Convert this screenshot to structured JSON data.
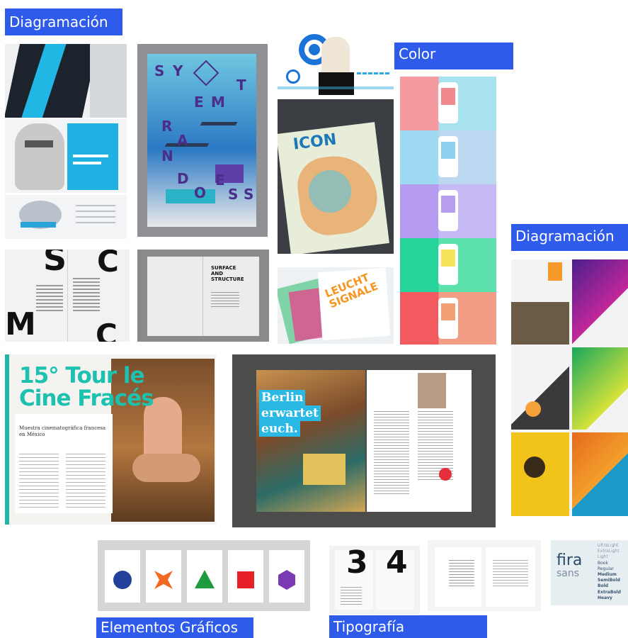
{
  "labels": {
    "diagramacion_top": "Diagramación",
    "color": "Color",
    "diagramacion_right": "Diagramación",
    "elementos": "Elementos Gráficos",
    "tipografia": "Tipografía"
  },
  "poster": {
    "letters": [
      "S",
      "Y",
      "T",
      "E",
      "M",
      "R",
      "A",
      "N",
      "D",
      "O",
      "E",
      "S",
      "S"
    ]
  },
  "magazine_icon": {
    "title": "ICON"
  },
  "swiss": {
    "letters": [
      "S",
      "C",
      "M",
      "C"
    ]
  },
  "surface_book": {
    "title_lines": [
      "SURFACE",
      "AND",
      "STRUCTURE"
    ]
  },
  "leucht": {
    "title_lines": [
      "LEUCHT",
      "SIGNALE"
    ]
  },
  "cine": {
    "title_line1": "15° Tour le",
    "title_line2": "Cine Fracés",
    "subtitle": "Muestra cinematográfica francesa en México"
  },
  "berlin": {
    "lines": [
      "Berlin",
      "erwartet",
      "euch."
    ]
  },
  "shapes": {
    "colors": [
      "#23409a",
      "#f26a21",
      "#1f9a3e",
      "#e52027",
      "#7a3ab4"
    ]
  },
  "typo_book": {
    "numbers": [
      "3",
      "4"
    ]
  },
  "fira": {
    "name_line1": "fira",
    "name_line2": "sans",
    "weights": [
      "UltraLight",
      "ExtraLight",
      "Light",
      "Book",
      "Regular",
      "Medium",
      "SemiBold",
      "Bold",
      "ExtraBold",
      "Heavy"
    ]
  }
}
